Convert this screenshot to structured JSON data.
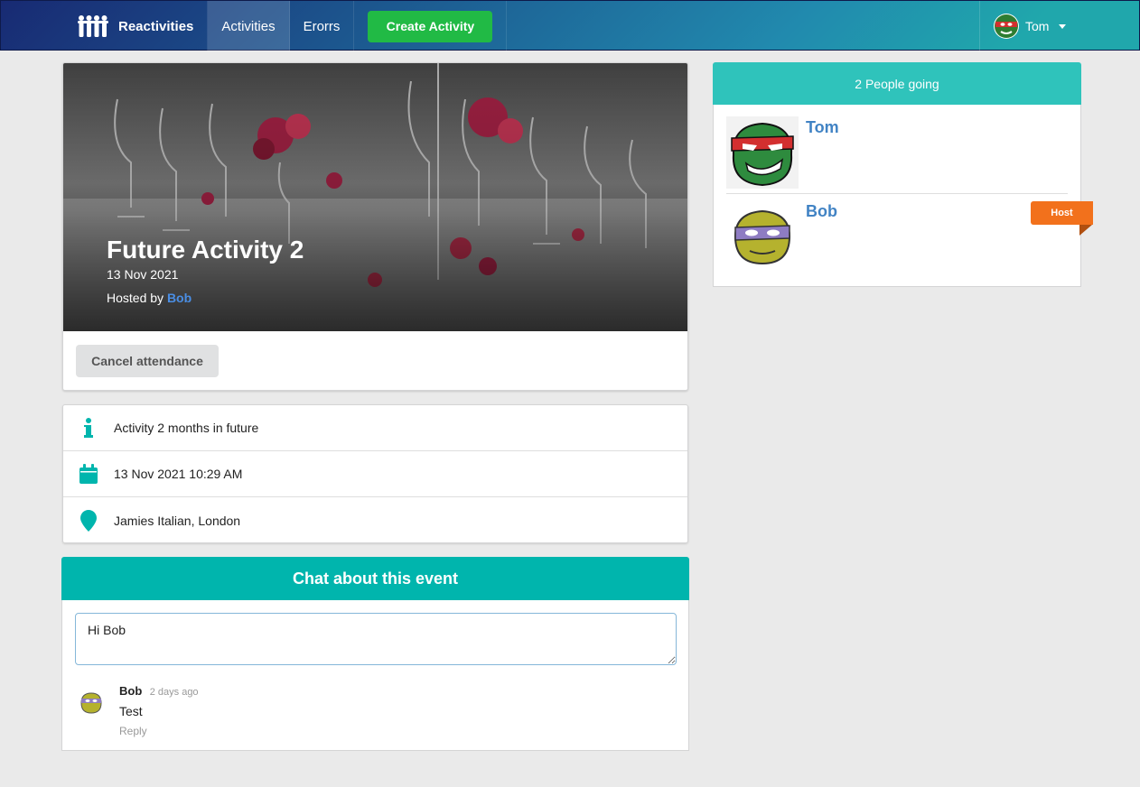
{
  "nav": {
    "brand": "Reactivities",
    "activities": "Activities",
    "errors": "Erorrs",
    "create_button": "Create Activity",
    "user_name": "Tom"
  },
  "activity": {
    "title": "Future Activity 2",
    "date": "13 Nov 2021",
    "hosted_by_label": "Hosted by",
    "host_name": "Bob",
    "cancel_button": "Cancel attendance",
    "description": "Activity 2 months in future",
    "datetime": "13 Nov 2021 10:29 AM",
    "venue": "Jamies Italian, London"
  },
  "chat": {
    "title": "Chat about this event",
    "input_value": "Hi Bob",
    "comments": [
      {
        "author": "Bob",
        "time": "2 days ago",
        "text": "Test",
        "reply_label": "Reply"
      }
    ]
  },
  "sidebar": {
    "header": "2 People going",
    "attendees": [
      {
        "name": "Tom",
        "badge": ""
      },
      {
        "name": "Bob",
        "badge": "Host"
      }
    ]
  },
  "colors": {
    "teal": "#00b5ad",
    "green_button": "#21ba45",
    "host_ribbon": "#f2711c",
    "link_blue": "#4183c4"
  },
  "icons": {
    "info": "info-icon",
    "calendar": "calendar-icon",
    "location": "map-marker-icon",
    "caret": "dropdown-caret-icon"
  }
}
